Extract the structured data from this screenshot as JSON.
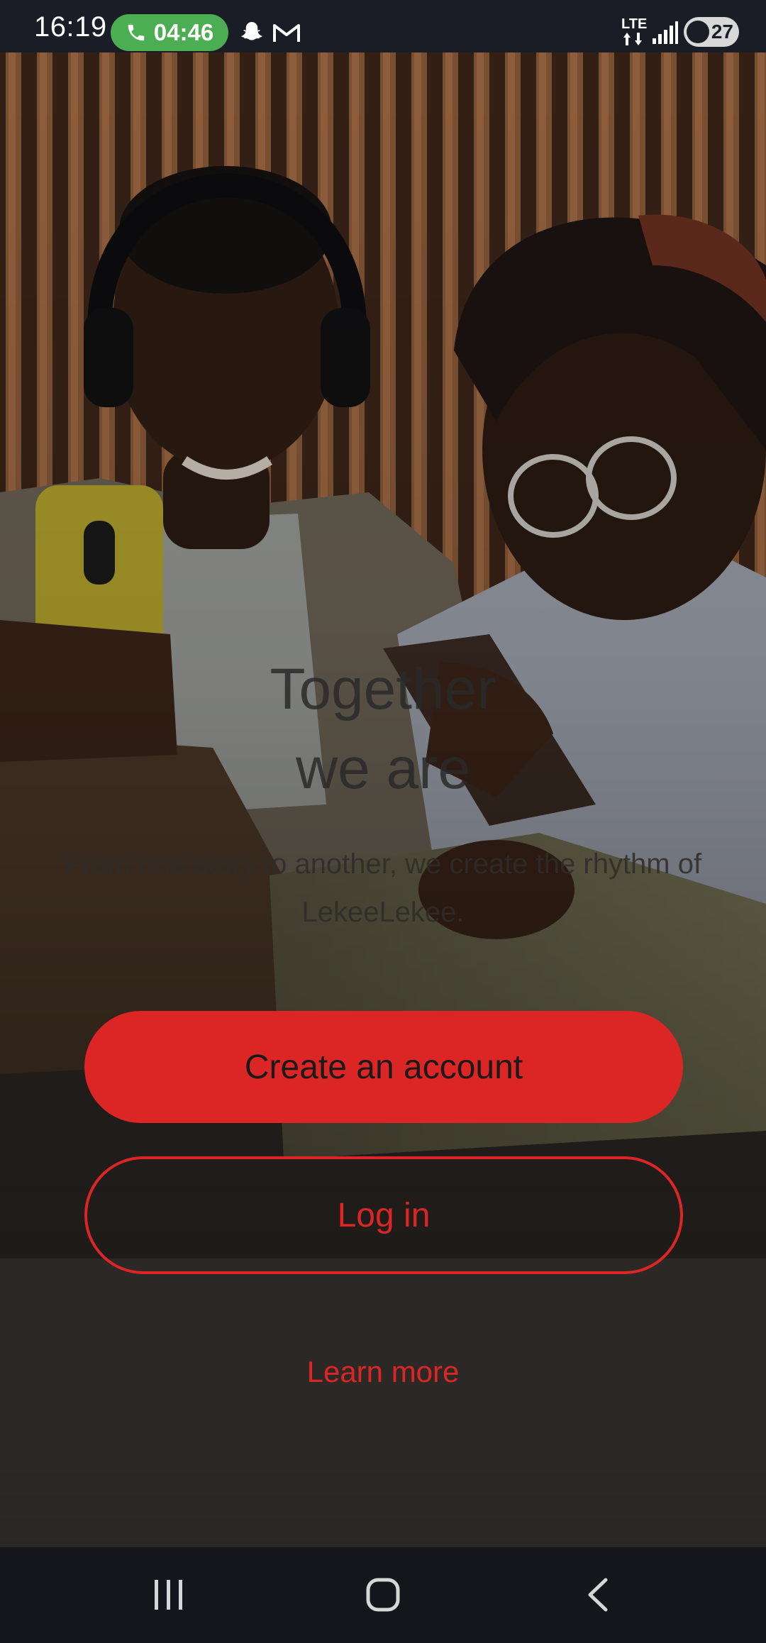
{
  "status_bar": {
    "time": "16:19",
    "call_timer": "04:46",
    "network": "LTE",
    "battery": "27",
    "icons": [
      "phone-icon",
      "snapchat-icon",
      "gmail-icon",
      "lte-data-icon",
      "signal-icon",
      "battery-icon"
    ]
  },
  "hero": {
    "headline": "Together\nwe are",
    "tagline": "From one story to another, we create the rhythm of LekeeLekee."
  },
  "actions": {
    "create_account": "Create an account",
    "log_in": "Log in",
    "learn_more": "Learn more"
  },
  "nav_bar": {
    "icons": [
      "recent-apps-icon",
      "home-icon",
      "back-icon"
    ]
  },
  "colors": {
    "accent": "#dc2626",
    "call_pill": "#4cae52",
    "status_bar_bg": "#1b1d26",
    "nav_bar_bg": "#14161c"
  }
}
